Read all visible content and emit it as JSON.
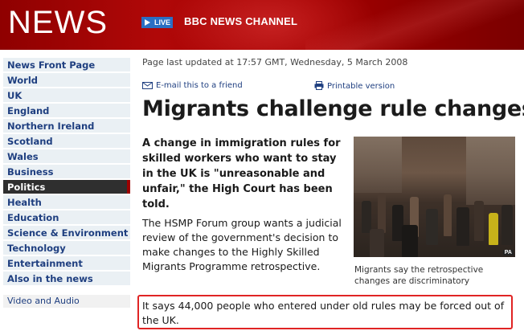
{
  "banner": {
    "logo_text": "NEWS",
    "live_label": "LIVE",
    "channel_label": "BBC NEWS CHANNEL",
    "bg_color": "#a30000"
  },
  "sidebar": {
    "items": [
      {
        "label": "News Front Page",
        "active": false
      },
      {
        "label": "World",
        "active": false
      },
      {
        "label": "UK",
        "active": false
      },
      {
        "label": "England",
        "active": false
      },
      {
        "label": "Northern Ireland",
        "active": false
      },
      {
        "label": "Scotland",
        "active": false
      },
      {
        "label": "Wales",
        "active": false
      },
      {
        "label": "Business",
        "active": false
      },
      {
        "label": "Politics",
        "active": true
      },
      {
        "label": "Health",
        "active": false
      },
      {
        "label": "Education",
        "active": false
      },
      {
        "label": "Science & Environment",
        "active": false
      },
      {
        "label": "Technology",
        "active": false
      },
      {
        "label": "Entertainment",
        "active": false
      },
      {
        "label": "Also in the news",
        "active": false
      }
    ],
    "sub_item": "Video and Audio"
  },
  "article": {
    "updated": "Page last updated at 17:57 GMT, Wednesday, 5 March 2008",
    "email_link": "E-mail this to a friend",
    "print_link": "Printable version",
    "headline": "Migrants challenge rule changes",
    "lede": "A change in immigration rules for skilled workers who want to stay in the UK is \"unreasonable and unfair,\" the High Court has been told.",
    "paragraph1": "The HSMP Forum group wants a judicial review of the government's decision to make changes to the Highly Skilled Migrants Programme retrospective.",
    "photo_credit": "PA",
    "caption": "Migrants say the retrospective changes are discriminatory",
    "highlighted_paragraph": "It says 44,000 people who entered under old rules may be forced out of the UK."
  },
  "colors": {
    "nav_text": "#1f3f80",
    "nav_bg": "#eaf0f4",
    "active_bg": "#2f2f2f",
    "highlight_border": "#e02424"
  }
}
